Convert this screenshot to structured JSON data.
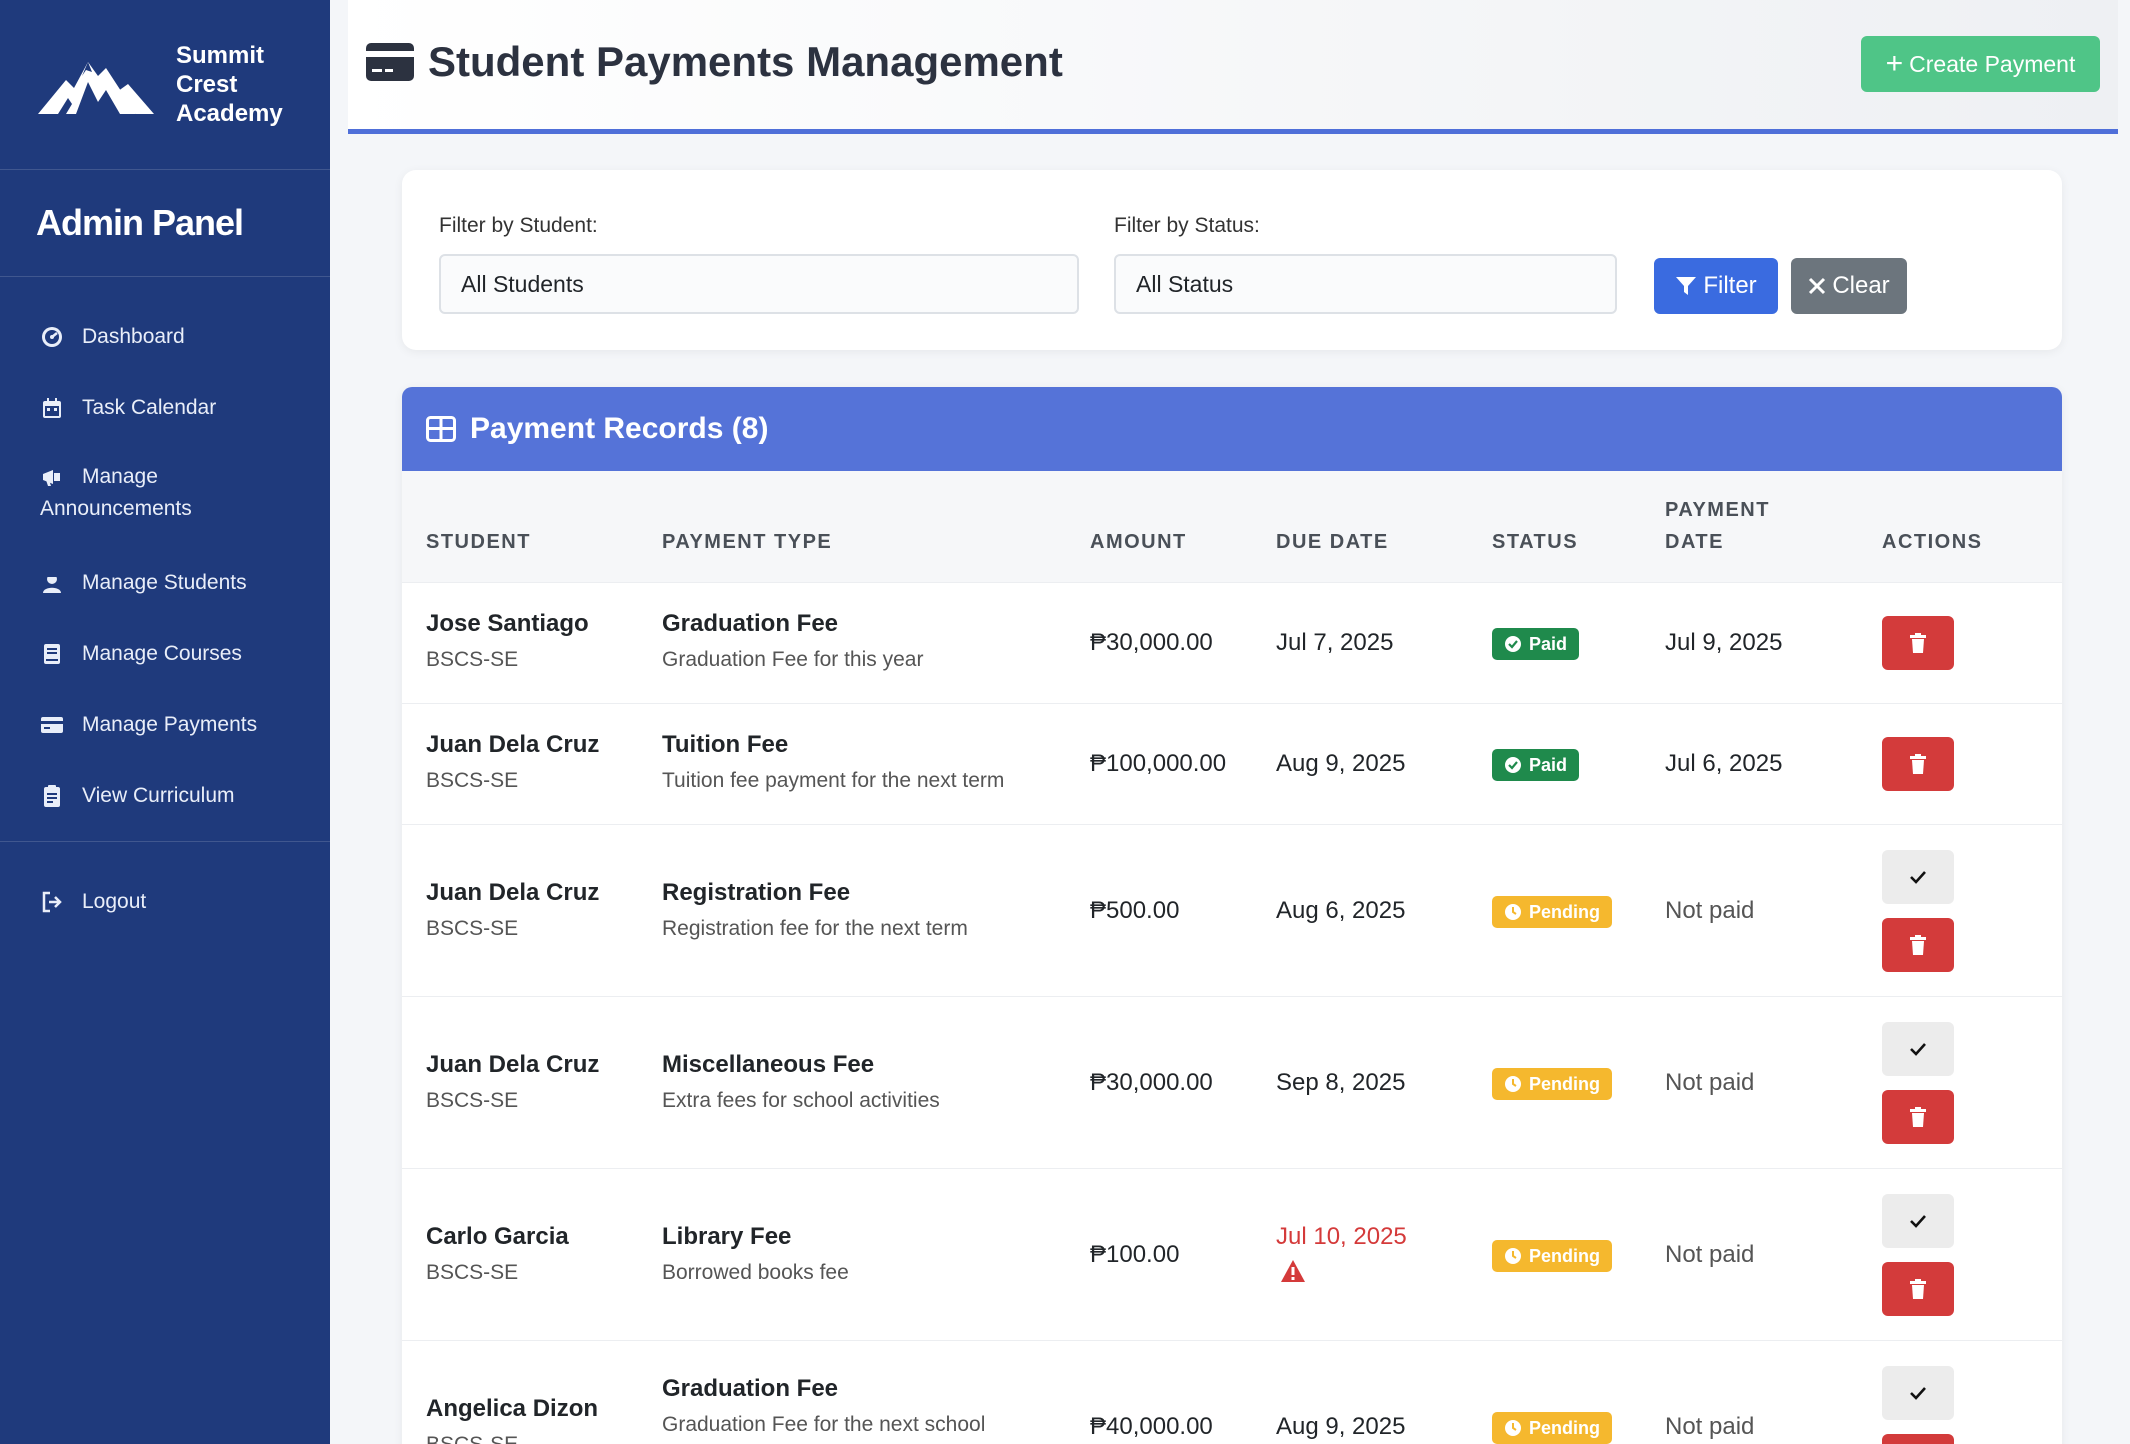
{
  "brand": {
    "name": "Summit Crest Academy"
  },
  "panel_title": "Admin Panel",
  "nav": [
    {
      "label": "Dashboard",
      "icon": "dashboard-icon"
    },
    {
      "label": "Task Calendar",
      "icon": "calendar-icon"
    },
    {
      "label": "Manage Announcements",
      "icon": "megaphone-icon"
    },
    {
      "label": "Manage Students",
      "icon": "student-icon"
    },
    {
      "label": "Manage Courses",
      "icon": "book-icon"
    },
    {
      "label": "Manage Payments",
      "icon": "credit-card-icon"
    },
    {
      "label": "View Curriculum",
      "icon": "clipboard-icon"
    },
    {
      "label": "Logout",
      "icon": "logout-icon"
    }
  ],
  "header": {
    "title": "Student Payments Management",
    "create_label": "Create Payment"
  },
  "filters": {
    "student_label": "Filter by Student:",
    "student_value": "All Students",
    "status_label": "Filter by Status:",
    "status_value": "All Status",
    "filter_button": "Filter",
    "clear_button": "Clear"
  },
  "records": {
    "title": "Payment Records (8)",
    "columns": [
      "STUDENT",
      "PAYMENT TYPE",
      "AMOUNT",
      "DUE DATE",
      "STATUS",
      "PAYMENT DATE",
      "ACTIONS"
    ],
    "rows": [
      {
        "student": "Jose Santiago",
        "program": "BSCS-SE",
        "type": "Graduation Fee",
        "desc": "Graduation Fee for this year",
        "amount": "₱30,000.00",
        "due": "Jul 7, 2025",
        "status": "Paid",
        "payment_date": "Jul 9, 2025"
      },
      {
        "student": "Juan Dela Cruz",
        "program": "BSCS-SE",
        "type": "Tuition Fee",
        "desc": "Tuition fee payment for the next term",
        "amount": "₱100,000.00",
        "due": "Aug 9, 2025",
        "status": "Paid",
        "payment_date": "Jul 6, 2025"
      },
      {
        "student": "Juan Dela Cruz",
        "program": "BSCS-SE",
        "type": "Registration Fee",
        "desc": "Registration fee for the next term",
        "amount": "₱500.00",
        "due": "Aug 6, 2025",
        "status": "Pending",
        "payment_date": "Not paid"
      },
      {
        "student": "Juan Dela Cruz",
        "program": "BSCS-SE",
        "type": "Miscellaneous Fee",
        "desc": "Extra fees for school activities",
        "amount": "₱30,000.00",
        "due": "Sep 8, 2025",
        "status": "Pending",
        "payment_date": "Not paid"
      },
      {
        "student": "Carlo Garcia",
        "program": "BSCS-SE",
        "type": "Library Fee",
        "desc": "Borrowed books fee",
        "amount": "₱100.00",
        "due": "Jul 10, 2025",
        "status": "Pending",
        "payment_date": "Not paid"
      },
      {
        "student": "Angelica Dizon",
        "program": "BSCS-SE",
        "type": "Graduation Fee",
        "desc": "Graduation Fee for the next school",
        "amount": "₱40,000.00",
        "due": "Aug 9, 2025",
        "status": "Pending",
        "payment_date": "Not paid"
      }
    ]
  },
  "colors": {
    "sidebar": "#1f3a7c",
    "accent": "#4f6fd9",
    "records_header": "#5573d8",
    "create_button": "#4fc587",
    "paid": "#1f8a4c",
    "pending": "#f5b82e",
    "danger": "#d33b3b"
  }
}
